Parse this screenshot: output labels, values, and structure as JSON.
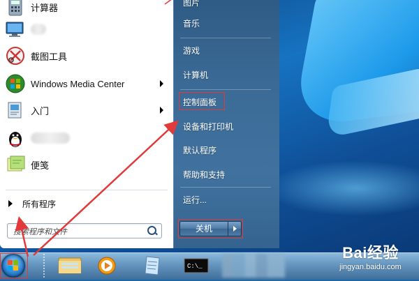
{
  "start_menu": {
    "pinned": [
      {
        "label": "计算器",
        "icon": "calculator-icon"
      },
      {
        "label": "",
        "icon": "remote-desktop-icon",
        "blurred": true
      },
      {
        "label": "截图工具",
        "icon": "scissors-icon"
      },
      {
        "label": "Windows Media Center",
        "icon": "media-center-icon",
        "submenu": true
      },
      {
        "label": "入门",
        "icon": "getting-started-icon",
        "submenu": true
      },
      {
        "label": "",
        "icon": "qq-penguin-icon",
        "blurred": true
      },
      {
        "label": "便笺",
        "icon": "sticky-notes-icon"
      }
    ],
    "all_programs": "所有程序",
    "search_placeholder": "搜索程序和文件",
    "right_items": [
      {
        "label": "图片"
      },
      {
        "label": "音乐"
      },
      {
        "label": "游戏"
      },
      {
        "label": "计算机"
      },
      {
        "label": "控制面板",
        "highlighted": true
      },
      {
        "label": "设备和打印机"
      },
      {
        "label": "默认程序"
      },
      {
        "label": "帮助和支持"
      },
      {
        "label": "运行..."
      }
    ],
    "shutdown_label": "关机"
  },
  "taskbar": {
    "items": [
      {
        "icon": "explorer-folder-icon"
      },
      {
        "icon": "media-player-icon"
      },
      {
        "icon": "notepad-icon"
      },
      {
        "icon": "command-prompt-icon",
        "label": "C:\\_"
      }
    ]
  },
  "watermark": {
    "logo": "Bai经验",
    "url": "jingyan.baidu.com"
  },
  "colors": {
    "annotation": "#e23a3a",
    "right_pane": "#3b6a96",
    "desktop": "#1673c2"
  }
}
